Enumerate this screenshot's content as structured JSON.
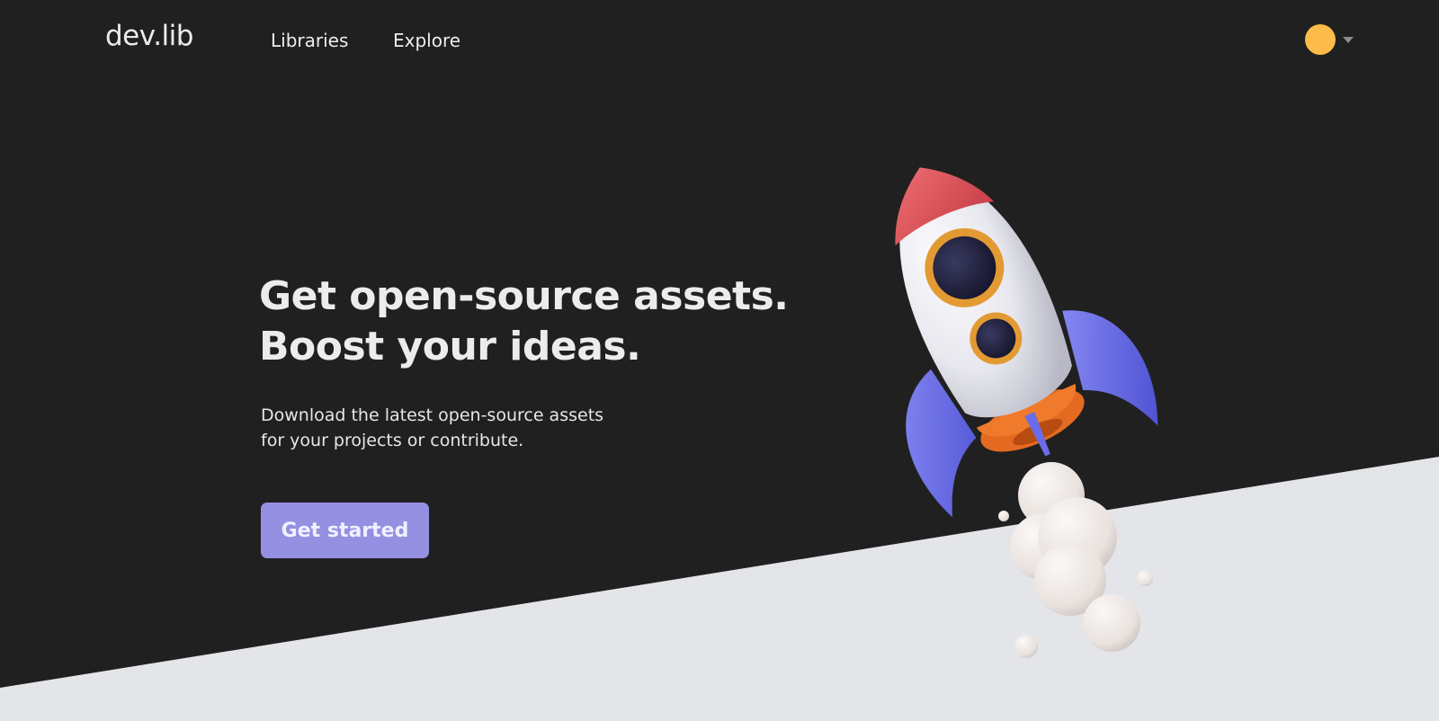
{
  "header": {
    "logo": "dev.lib",
    "nav": [
      {
        "label": "Libraries"
      },
      {
        "label": "Explore"
      }
    ]
  },
  "hero": {
    "title_lines": [
      "Get open-source assets.",
      "Boost your ideas."
    ],
    "subtitle_lines": [
      "Download the latest open-source assets",
      "for your projects or contribute."
    ],
    "cta_label": "Get started"
  },
  "colors": {
    "background": "#202020",
    "ground": "#e4e5e9",
    "accent": "#9590e1",
    "avatar": "#fcbc4a",
    "rocket_nose": "#e0595a",
    "rocket_fins": "#6a6de8",
    "rocket_base": "#f07a2c"
  },
  "icons": {
    "user_avatar": "avatar-circle",
    "user_menu_caret": "caret-down-icon",
    "illustration": "rocket-launch-illustration"
  }
}
